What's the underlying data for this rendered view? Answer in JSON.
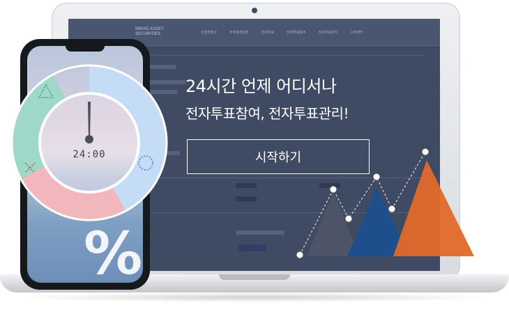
{
  "screen": {
    "site_logo": "MIRAE ASSET",
    "site_logo_sub": "SECURITIES",
    "nav_items": [
      "의결권행사",
      "주주총회일정",
      "전자투표",
      "전자투표참여",
      "전자투표관리",
      "고객센터"
    ]
  },
  "headline": {
    "line1": "24시간 언제 어디서나",
    "line2": "전자투표참여, 전자투표관리!"
  },
  "start_button": {
    "label": "시작하기"
  },
  "phone": {
    "time": "24:00",
    "percent": "%"
  },
  "colors": {
    "screen_bg": "#3f4a63",
    "dial_teal": "#9fd8c8",
    "dial_pink": "#f2b6bd",
    "dial_blue": "#c4dcf6",
    "tri_gray": "#4a5163",
    "tri_blue": "#1f4f8a",
    "tri_orange": "#e06a28"
  }
}
